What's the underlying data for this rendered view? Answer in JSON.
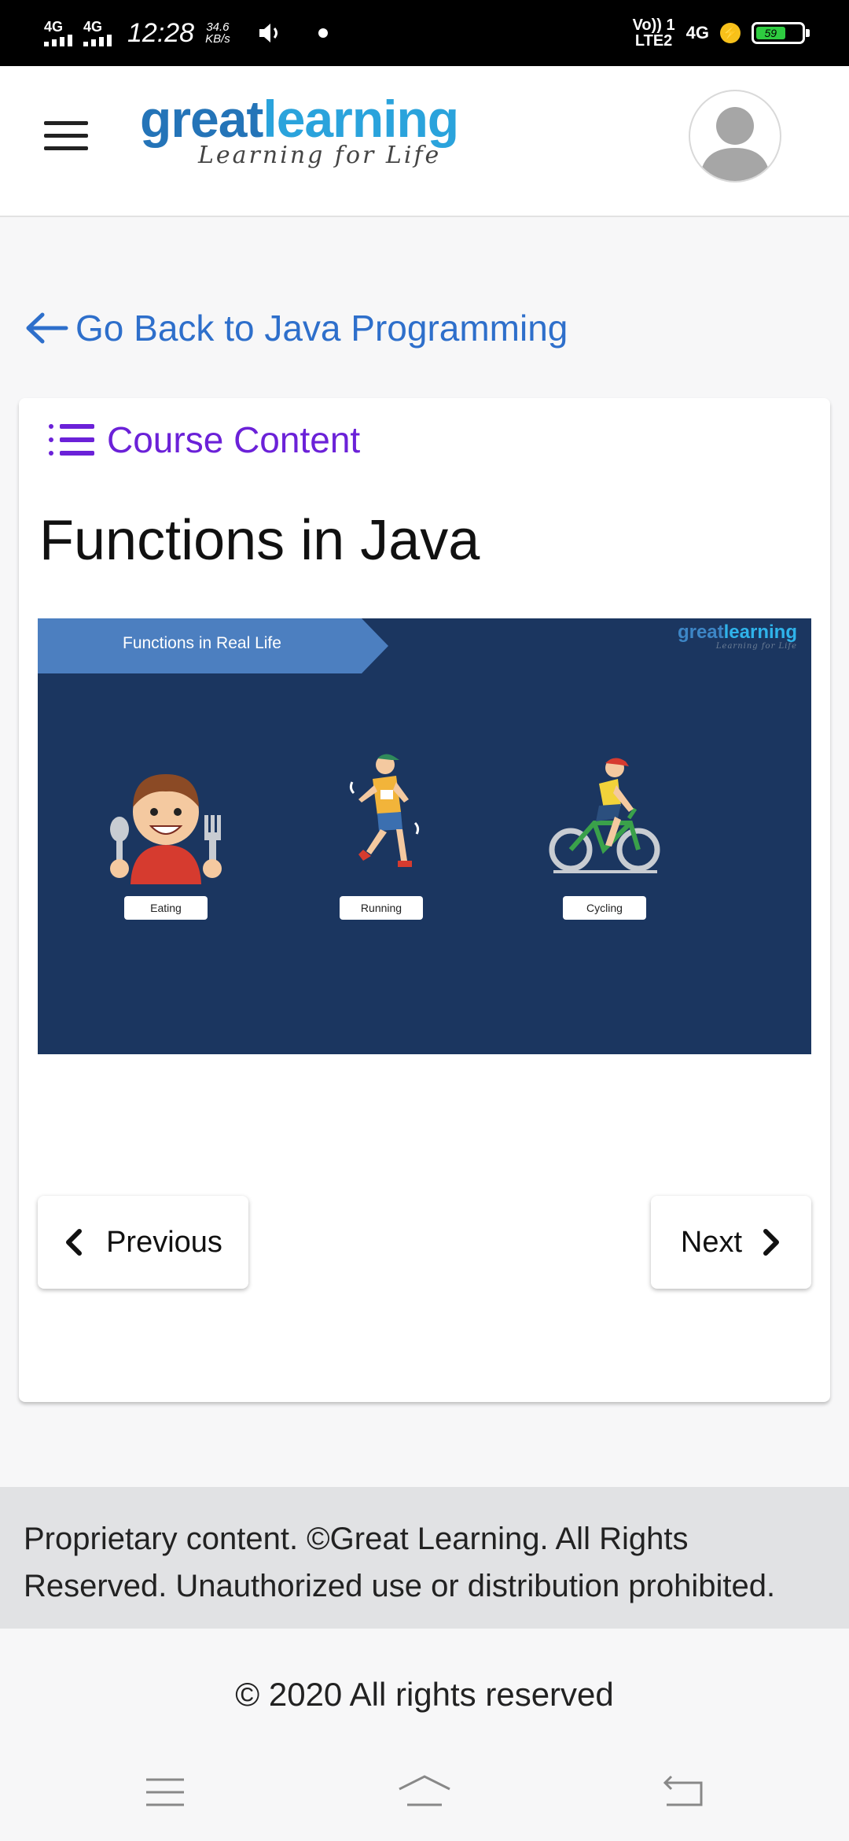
{
  "status_bar": {
    "network_left_1": "4G",
    "network_left_2": "4G",
    "time": "12:28",
    "speed_value": "34.6",
    "speed_unit": "KB/s",
    "network_right_1": "Vo)) 1",
    "network_right_2": "LTE2",
    "network_right_3": "4G",
    "battery_level": "59"
  },
  "header": {
    "logo_part1": "great",
    "logo_part2": "learning",
    "logo_tagline": "Learning for Life"
  },
  "back_link": {
    "label": "Go Back to Java Programming"
  },
  "card": {
    "course_content_label": "Course Content",
    "lesson_title": "Functions in Java",
    "slide": {
      "banner_title": "Functions in Real Life",
      "logo_part1": "great",
      "logo_part2": "learning",
      "logo_tagline": "Learning for Life",
      "figures": [
        {
          "label": "Eating"
        },
        {
          "label": "Running"
        },
        {
          "label": "Cycling"
        }
      ]
    },
    "previous_label": "Previous",
    "next_label": "Next"
  },
  "footer": {
    "proprietary_notice": "Proprietary content. ©Great Learning. All Rights Reserved. Unauthorized use or distribution prohibited.",
    "copyright": "© 2020 All rights reserved"
  },
  "colors": {
    "link_blue": "#2e6fcb",
    "course_content_purple": "#6b21d8",
    "slide_background": "#1b3660",
    "banner_blue": "#4c7fc0"
  }
}
